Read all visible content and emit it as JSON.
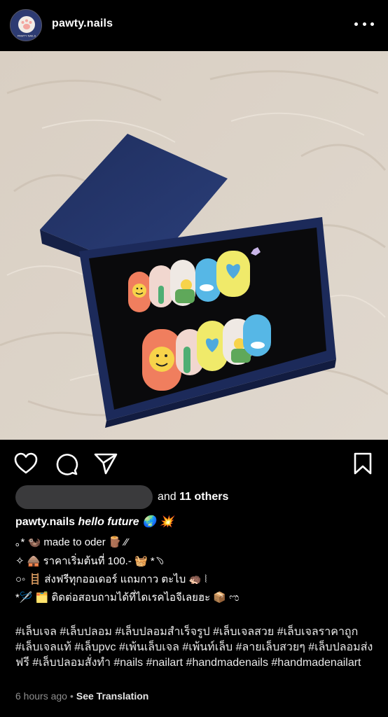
{
  "post": {
    "username": "pawty.nails",
    "avatar_label": "PAWTY NAILS",
    "likes": {
      "suffix_text": "and",
      "others": "11 others"
    },
    "caption": {
      "username": "pawty.nails",
      "title": "hello future 🌏 💥",
      "lines": [
        "｡* 🦦 made to oder 🪵 ⁄⁄",
        "✧ 🛖 ราคาเริ่มต้นที่ 100.- 🧺 *﹆",
        "○◦ 🪜 ส่งฟรีทุกออเดอร์ แถมกาว ตะไบ 🦔 ⦚",
        "*🪡 🗂️ ติดต่อสอบถามได้ที่ไดเรคไอจีเลยฮะ 📦 ಌ"
      ],
      "hashtags": "#เล็บเจล #เล็บปลอม #เล็บปลอมสำเร็จรูป #เล็บเจลสวย #เล็บเจลราคาถูก #เล็บเจลแท้ #เล็บpvc  #เพ้นเล็บเจล #เพ้นท์เล็บ #ลายเล็บสวยๆ #เล็บปลอมส่งฟรี #เล็บปลอมสั่งทำ #nails #nailart #handmadenails #handmadenailart"
    },
    "time": "6 hours ago",
    "separator": "•",
    "translate": "See Translation"
  },
  "icons": {
    "like": "heart-icon",
    "comment": "comment-icon",
    "share": "send-icon",
    "save": "bookmark-icon",
    "more": "more-dots-icon"
  },
  "colors": {
    "background": "#000000",
    "text": "#ffffff",
    "muted": "#8e8e8e"
  }
}
